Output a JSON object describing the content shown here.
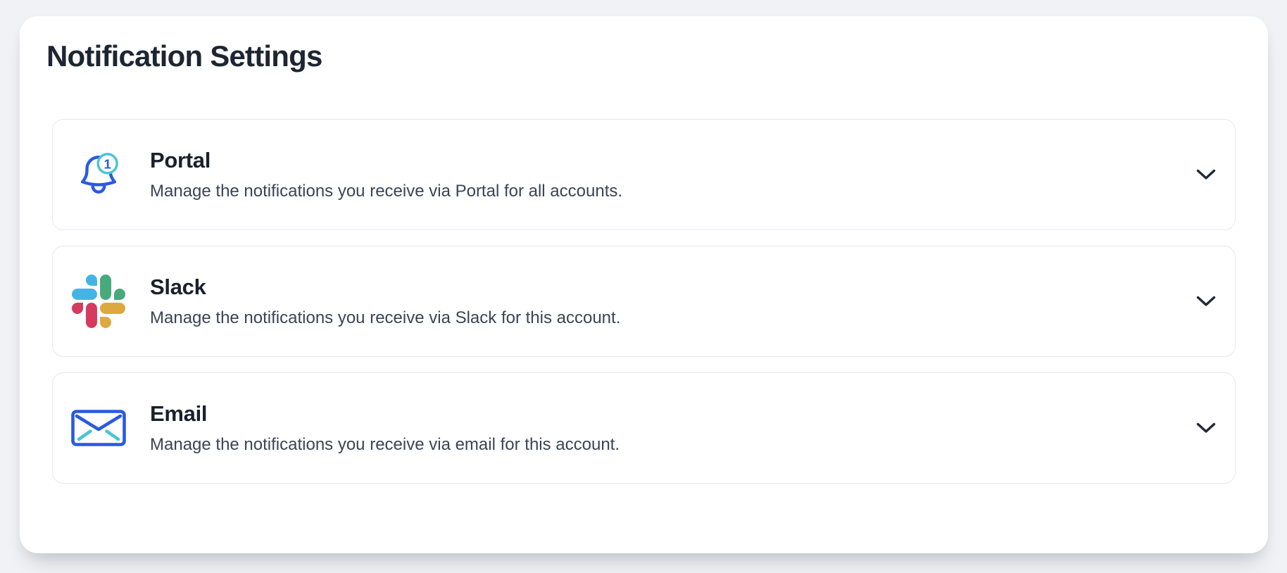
{
  "page": {
    "title": "Notification Settings"
  },
  "sections": [
    {
      "id": "portal",
      "title": "Portal",
      "description": "Manage the notifications you receive via Portal for all accounts.",
      "icon": "bell-notification-icon",
      "badge_count": "1"
    },
    {
      "id": "slack",
      "title": "Slack",
      "description": "Manage the notifications you receive via Slack for this account.",
      "icon": "slack-logo-icon"
    },
    {
      "id": "email",
      "title": "Email",
      "description": "Manage the notifications you receive via email for this account.",
      "icon": "email-envelope-icon"
    }
  ],
  "icons": {
    "expand": "chevron-down-icon"
  },
  "colors": {
    "accent_blue": "#2a5ae0",
    "accent_teal": "#49c5d4",
    "chevron": "#1f2937",
    "slack_blue": "#45b4e5",
    "slack_green": "#47a97c",
    "slack_red": "#d53a5f",
    "slack_yellow": "#dda83e"
  }
}
